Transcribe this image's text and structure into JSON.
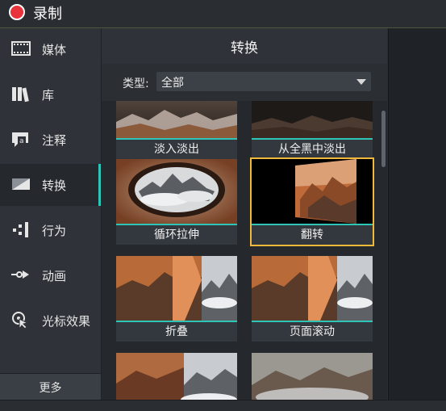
{
  "app": {
    "title": "录制",
    "record_color": "#e8323c"
  },
  "sidebar": {
    "items": [
      {
        "label": "媒体",
        "icon": "film-icon"
      },
      {
        "label": "库",
        "icon": "library-icon"
      },
      {
        "label": "注释",
        "icon": "annotation-icon"
      },
      {
        "label": "转换",
        "icon": "transition-icon",
        "active": true
      },
      {
        "label": "行为",
        "icon": "behavior-icon"
      },
      {
        "label": "动画",
        "icon": "animation-icon"
      },
      {
        "label": "光标效果",
        "icon": "cursor-effect-icon"
      }
    ],
    "more_label": "更多"
  },
  "panel": {
    "title": "转换",
    "filter_label": "类型:",
    "filter_value": "全部"
  },
  "transitions": [
    {
      "label": "淡入淡出"
    },
    {
      "label": "从全黑中淡出"
    },
    {
      "label": "循环拉伸"
    },
    {
      "label": "翻转",
      "selected": true
    },
    {
      "label": "折叠"
    },
    {
      "label": "页面滚动"
    }
  ],
  "colors": {
    "accent": "#2ec4b6",
    "selection": "#f0b93a"
  }
}
